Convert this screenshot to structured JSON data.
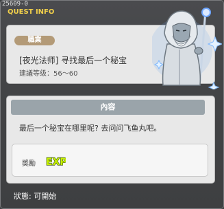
{
  "window": {
    "id": "25609-0",
    "title": "QUEST INFO"
  },
  "quest": {
    "job_badge": "職業",
    "name": "[夜光法师] 寻找最后一个秘宝",
    "level": "建議等级：56～60"
  },
  "content": {
    "section_label": "內容",
    "text": "最后一个秘宝在哪里呢? 去问问飞鱼丸吧。"
  },
  "reward": {
    "label": "獎勵",
    "icon": "exp-icon",
    "icon_text": "EXP"
  },
  "status": {
    "text": "狀態:  可開始"
  },
  "colors": {
    "title": "#f2d04a",
    "badge": "#b39a77",
    "section_bar": "#9aa4aa",
    "exp": "#c6f000"
  }
}
